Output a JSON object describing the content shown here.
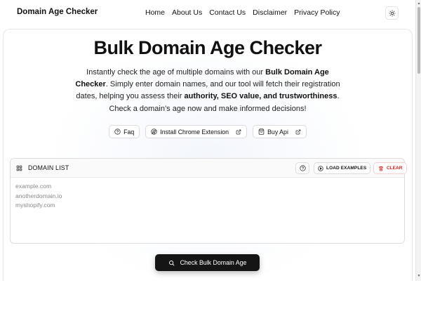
{
  "nav": {
    "brand": "Domain Age Checker",
    "links": [
      "Home",
      "About Us",
      "Contact Us",
      "Disclaimer",
      "Privacy Policy"
    ]
  },
  "hero": {
    "title": "Bulk Domain Age Checker",
    "desc_1": "Instantly check the age of multiple domains with our ",
    "desc_bold_1": "Bulk Domain Age Checker",
    "desc_2": ". Simply enter domain names, and our tool will fetch their registration dates, helping you assess their ",
    "desc_bold_2": "authority, SEO value, and trustworthiness",
    "desc_3": ".",
    "sub": "Check a domain’s age now and make informed decisions!"
  },
  "chips": {
    "faq": "Faq",
    "extension": "Install Chrome Extension",
    "api": "Buy Api"
  },
  "panel": {
    "title": "DOMAIN LIST",
    "load_examples": "LOAD EXAMPLES",
    "clear": "CLEAR",
    "domains": [
      "example.com",
      "anotherdomain.io",
      "myshopify.com"
    ]
  },
  "check_button": "Check Bulk Domain Age",
  "colors": {
    "accent": "#151515",
    "danger": "#d42020",
    "placeholder": "#8a8a8a"
  }
}
